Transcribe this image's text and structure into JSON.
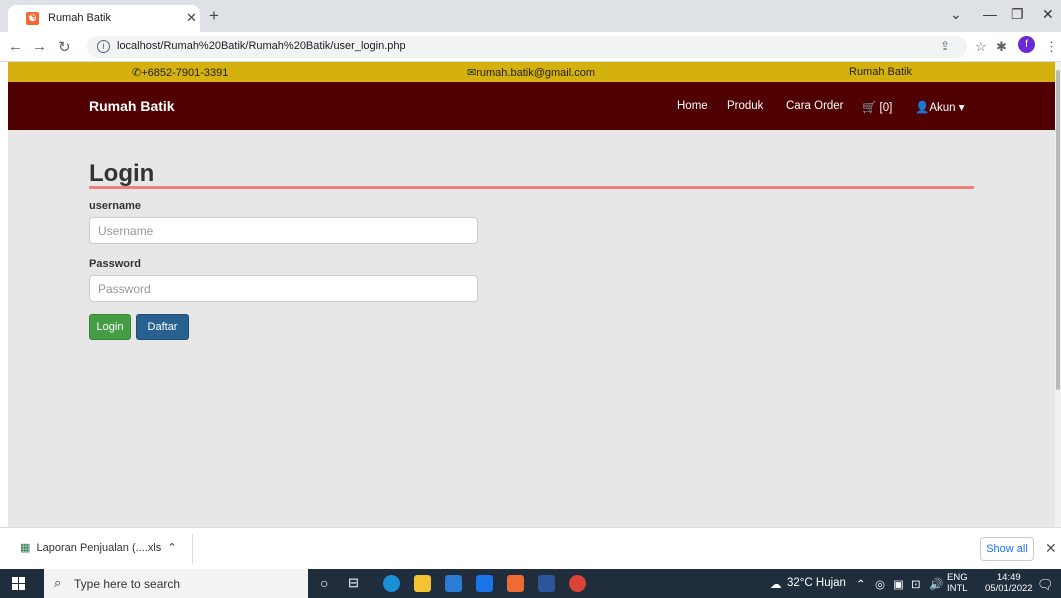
{
  "browser": {
    "tab_title": "Rumah Batik",
    "favicon_text": "ᗝ",
    "url": "localhost/Rumah%20Batik/Rumah%20Batik/user_login.php"
  },
  "topbar": {
    "phone": "+6852-7901-3391",
    "email": "rumah.batik@gmail.com",
    "name": "Rumah Batik"
  },
  "navbar": {
    "brand": "Rumah Batik",
    "home": "Home",
    "produk": "Produk",
    "cara_order": "Cara Order",
    "cart": "[0]",
    "akun": "Akun"
  },
  "login": {
    "title": "Login",
    "username_label": "username",
    "username_placeholder": "Username",
    "password_label": "Password",
    "password_placeholder": "Password",
    "login_button": "Login",
    "daftar_button": "Daftar"
  },
  "downloads": {
    "file": "Laporan Penjualan (....xls",
    "show_all": "Show all"
  },
  "taskbar": {
    "search_placeholder": "Type here to search",
    "weather": "32°C  Hujan",
    "lang_top": "ENG",
    "lang_bottom": "INTL",
    "time": "14:49",
    "date": "05/01/2022"
  },
  "colors": {
    "topstrip": "#d4b10f",
    "navbar": "#500000",
    "underline": "#f08080",
    "login_btn": "#449d44",
    "daftar_btn": "#286090"
  }
}
